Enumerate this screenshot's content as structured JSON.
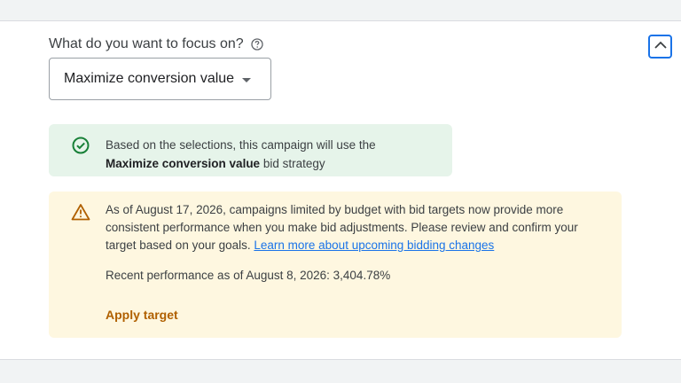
{
  "focus": {
    "question": "What do you want to focus on?",
    "selected": "Maximize conversion value"
  },
  "info": {
    "prefix": "Based on the selections, this campaign will use the",
    "strategy": "Maximize conversion value",
    "suffix": "bid strategy"
  },
  "warning": {
    "message": "As of August 17, 2026, campaigns limited by budget with bid targets now provide more consistent performance when you make bid adjustments. Please review and confirm your target based on your goals.",
    "link": "Learn more about upcoming bidding changes",
    "performance": "Recent performance as of August 8, 2026: 3,404.78%",
    "apply_label": "Apply target"
  },
  "colors": {
    "accent": "#1a73e8",
    "success_bg": "#e6f4ea",
    "success_icon": "#188038",
    "warning_bg": "#fef7e0",
    "warning_icon": "#b06000"
  },
  "icons": {
    "help": "help-circle-icon",
    "collapse": "chevron-up-icon",
    "dropdown": "caret-down-icon",
    "success": "check-circle-icon",
    "warning": "warning-triangle-icon"
  }
}
